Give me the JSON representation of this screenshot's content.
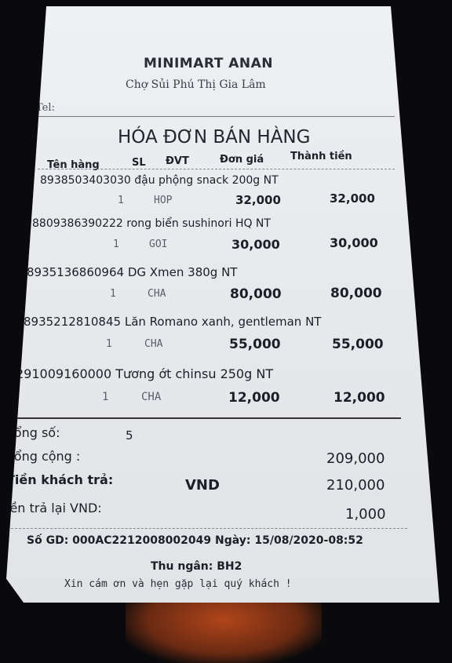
{
  "store": {
    "name": "MINIMART ANAN",
    "address": "Chợ Sủi Phú Thị Gia Lâm",
    "tel_label": "Tel:"
  },
  "invoice_title": "HÓA ĐƠN BÁN HÀNG",
  "columns": {
    "name": "Tên hàng",
    "qty": "SL",
    "unit": "ĐVT",
    "price": "Đơn giá",
    "total": "Thành tiền"
  },
  "items": [
    {
      "desc": "8938503403030 đậu phộng snack  200g NT",
      "qty": "1",
      "unit": "HOP",
      "price": "32,000",
      "total": "32,000"
    },
    {
      "desc": "8809386390222 rong biển sushinori HQ NT",
      "qty": "1",
      "unit": "GOI",
      "price": "30,000",
      "total": "30,000"
    },
    {
      "desc": "8935136860964 DG Xmen 380g NT",
      "qty": "1",
      "unit": "CHA",
      "price": "80,000",
      "total": "80,000"
    },
    {
      "desc": "8935212810845 Lăn Romano xanh, gentleman  NT",
      "qty": "1",
      "unit": "CHA",
      "price": "55,000",
      "total": "55,000"
    },
    {
      "desc": "291009160000 Tương ớt chinsu 250g NT",
      "qty": "1",
      "unit": "CHA",
      "price": "12,000",
      "total": "12,000"
    }
  ],
  "summary": {
    "count_label": "Tổng số:",
    "count_value": "5",
    "total_label": "Tổng cộng :",
    "total_value": "209,000",
    "paid_label": "Tiền khách trả:",
    "paid_currency": "VND",
    "paid_value": "210,000",
    "change_label": "iền trả lại VND:",
    "change_value": "1,000"
  },
  "footer": {
    "transaction": "Số GD: 000AC2212008002049 Ngày: 15/08/2020-08:52",
    "cashier": "Thu ngân: BH2",
    "thanks": "Xin cám ơn và hẹn gặp lại quý khách !"
  }
}
